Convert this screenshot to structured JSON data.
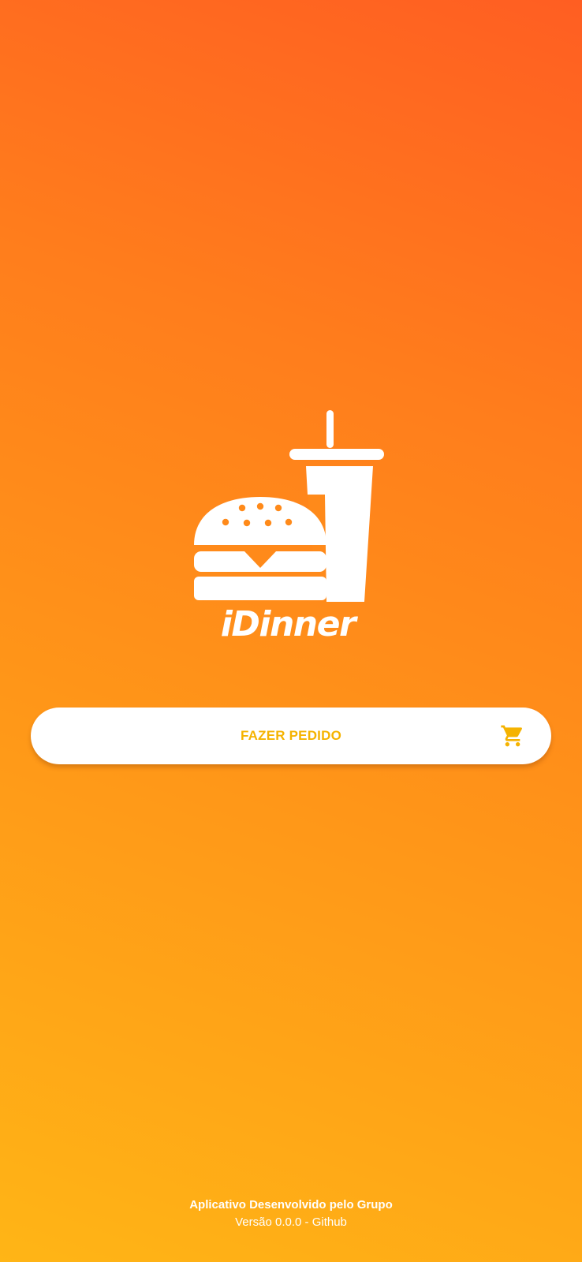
{
  "brand": {
    "name": "iDinner",
    "logo_icon": "burger-and-drink-icon"
  },
  "order_button": {
    "label": "FAZER PEDIDO",
    "icon": "cart-icon"
  },
  "footer": {
    "credit": "Aplicativo Desenvolvido pelo Grupo",
    "version": "Versão 0.0.0",
    "separator": " - ",
    "github_link": "Github"
  },
  "colors": {
    "gradient_top": "#ff5e22",
    "gradient_bottom": "#ffb516",
    "accent": "#f5b301",
    "button_bg": "#ffffff"
  }
}
